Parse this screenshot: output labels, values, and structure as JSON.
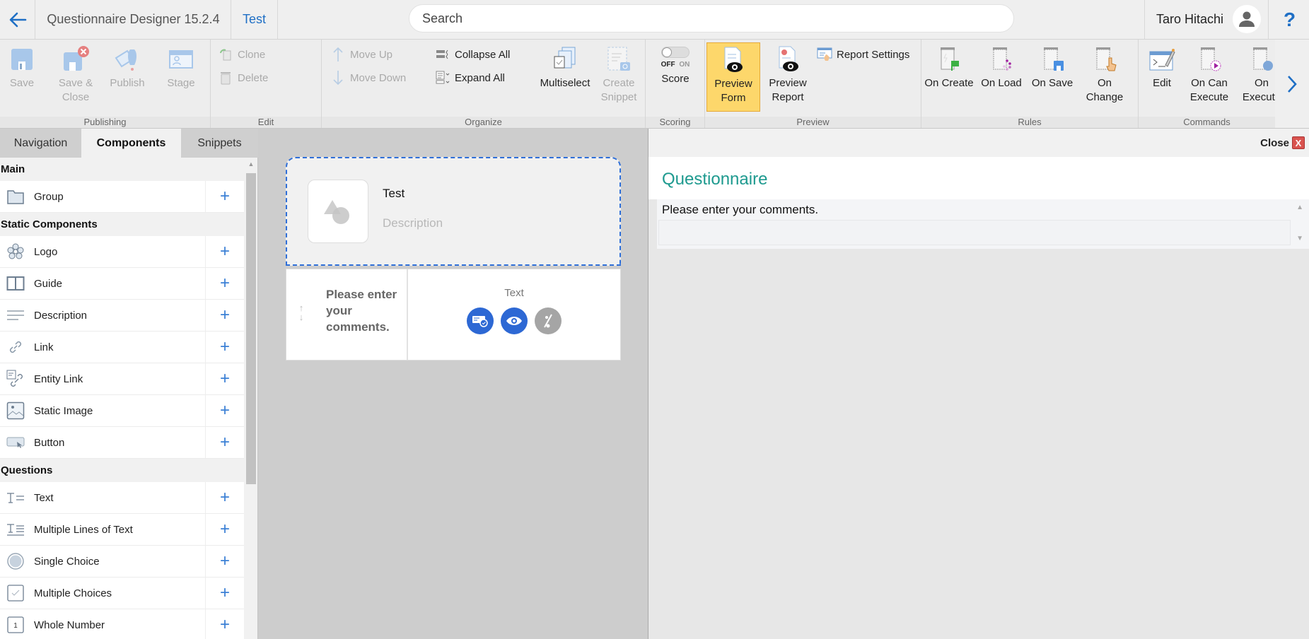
{
  "topbar": {
    "app_title": "Questionnaire Designer 15.2.4",
    "active_tab": "Test",
    "search_placeholder": "Search",
    "user_name": "Taro Hitachi",
    "help_label": "?"
  },
  "ribbon": {
    "groups": {
      "publishing": "Publishing",
      "edit": "Edit",
      "organize": "Organize",
      "scoring": "Scoring",
      "preview": "Preview",
      "rules": "Rules",
      "commands": "Commands"
    },
    "publishing": {
      "save": "Save",
      "save_close_1": "Save &",
      "save_close_2": "Close",
      "publish": "Publish",
      "stage": "Stage"
    },
    "edit": {
      "clone": "Clone",
      "delete": "Delete"
    },
    "organize": {
      "move_up": "Move Up",
      "move_down": "Move Down",
      "collapse_all": "Collapse All",
      "expand_all": "Expand All",
      "multiselect": "Multiselect",
      "create_snippet_1": "Create",
      "create_snippet_2": "Snippet"
    },
    "scoring": {
      "toggle_off": "OFF",
      "toggle_on": "ON",
      "toggle_state": "off",
      "score": "Score"
    },
    "preview": {
      "preview_form_1": "Preview",
      "preview_form_2": "Form",
      "preview_report_1": "Preview",
      "preview_report_2": "Report",
      "report_settings": "Report Settings"
    },
    "rules": {
      "on_create": "On Create",
      "on_load": "On Load",
      "on_save": "On Save",
      "on_change_1": "On",
      "on_change_2": "Change"
    },
    "commands": {
      "edit": "Edit",
      "on_can_execute_1": "On Can",
      "on_can_execute_2": "Execute",
      "on_execute_1": "On",
      "on_execute_2": "Execute"
    }
  },
  "left_panel": {
    "tabs": [
      "Navigation",
      "Components",
      "Snippets"
    ],
    "active_tab": "Components",
    "sections": [
      {
        "title": "Main",
        "items": [
          {
            "label": "Group",
            "icon": "folder-icon"
          }
        ]
      },
      {
        "title": "Static Components",
        "items": [
          {
            "label": "Logo",
            "icon": "logo-icon"
          },
          {
            "label": "Guide",
            "icon": "guide-icon"
          },
          {
            "label": "Description",
            "icon": "description-icon"
          },
          {
            "label": "Link",
            "icon": "link-icon"
          },
          {
            "label": "Entity Link",
            "icon": "entity-link-icon"
          },
          {
            "label": "Static Image",
            "icon": "image-icon"
          },
          {
            "label": "Button",
            "icon": "button-icon"
          }
        ]
      },
      {
        "title": "Questions",
        "items": [
          {
            "label": "Text",
            "icon": "text-icon"
          },
          {
            "label": "Multiple Lines of Text",
            "icon": "multiline-text-icon"
          },
          {
            "label": "Single Choice",
            "icon": "radio-icon"
          },
          {
            "label": "Multiple Choices",
            "icon": "checkbox-icon"
          },
          {
            "label": "Whole Number",
            "icon": "number-icon"
          }
        ]
      }
    ],
    "add_symbol": "+"
  },
  "canvas": {
    "header": {
      "title": "Test",
      "description_placeholder": "Description"
    },
    "question": {
      "text": "Please enter your comments.",
      "type": "Text",
      "icons": [
        "required-icon",
        "visibility-icon",
        "no-score-icon"
      ]
    }
  },
  "preview_panel": {
    "close_label": "Close",
    "close_symbol": "X",
    "title": "Questionnaire",
    "question_label": "Please enter your comments.",
    "answer_value": ""
  },
  "colors": {
    "accent_blue": "#1f6fc5",
    "preview_title_teal": "#1e9a8f",
    "active_ribbon_yellow": "#fdd76b",
    "selection_dashed_blue": "#2f6fd8",
    "close_red": "#d9534f"
  }
}
